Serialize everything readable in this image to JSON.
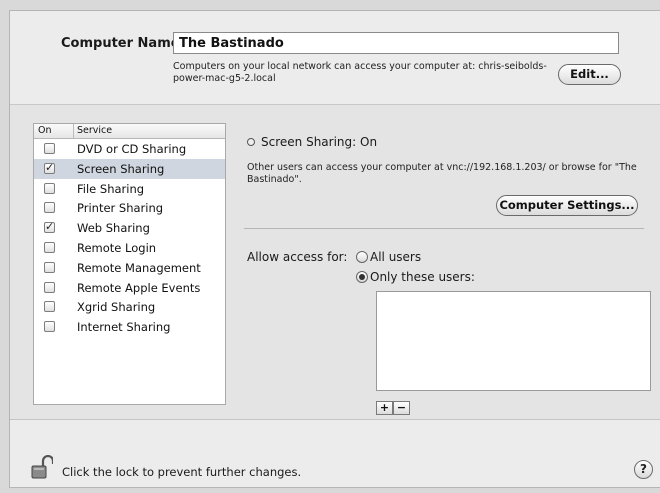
{
  "top": {
    "computer_name_label": "Computer Name:",
    "computer_name_value": "The Bastinado",
    "network_info": "Computers on your local network can access your computer at: chris-seibolds-power-mac-g5-2.local",
    "edit_button": "Edit..."
  },
  "services": {
    "header_on": "On",
    "header_service": "Service",
    "items": [
      {
        "label": "DVD or CD Sharing",
        "checked": false,
        "selected": false
      },
      {
        "label": "Screen Sharing",
        "checked": true,
        "selected": true
      },
      {
        "label": "File Sharing",
        "checked": false,
        "selected": false
      },
      {
        "label": "Printer Sharing",
        "checked": false,
        "selected": false
      },
      {
        "label": "Web Sharing",
        "checked": true,
        "selected": false
      },
      {
        "label": "Remote Login",
        "checked": false,
        "selected": false
      },
      {
        "label": "Remote Management",
        "checked": false,
        "selected": false
      },
      {
        "label": "Remote Apple Events",
        "checked": false,
        "selected": false
      },
      {
        "label": "Xgrid Sharing",
        "checked": false,
        "selected": false
      },
      {
        "label": "Internet Sharing",
        "checked": false,
        "selected": false
      }
    ]
  },
  "detail": {
    "status_title": "Screen Sharing: On",
    "description": "Other users can access your computer at vnc://192.168.1.203/ or browse for \"The Bastinado\".",
    "computer_settings_button": "Computer Settings...",
    "allow_access_label": "Allow access for:",
    "radio_all_users": "All users",
    "radio_only_these": "Only these users:",
    "selected_access": "only_these",
    "add_label": "+",
    "remove_label": "−"
  },
  "bottom": {
    "lock_text": "Click the lock to prevent further changes.",
    "help_label": "?"
  },
  "icons": {
    "lock": "lock-open-icon",
    "help": "help-icon",
    "status": "status-indicator-icon"
  }
}
